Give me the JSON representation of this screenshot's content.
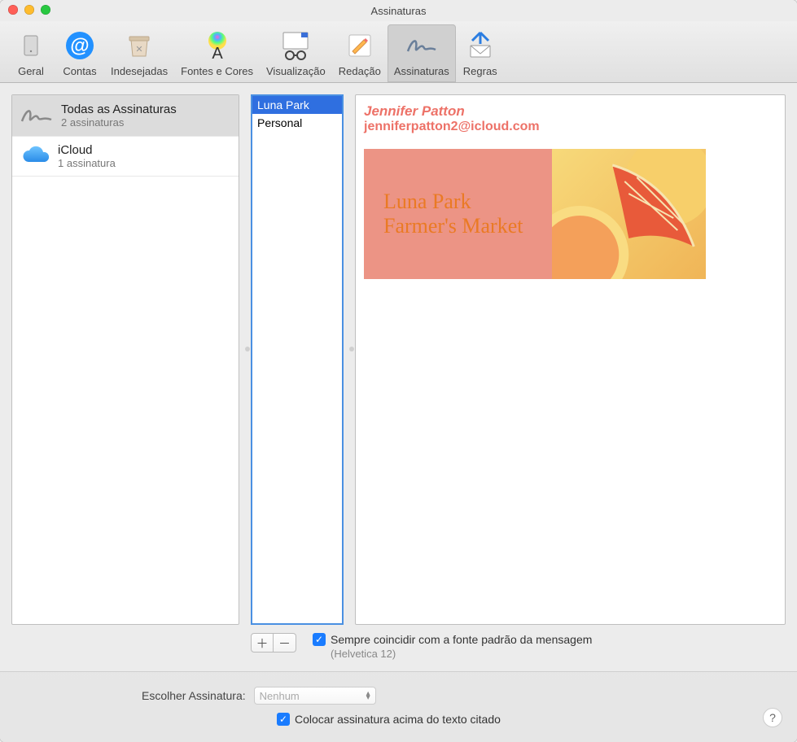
{
  "window": {
    "title": "Assinaturas"
  },
  "toolbar": {
    "items": [
      {
        "label": "Geral"
      },
      {
        "label": "Contas"
      },
      {
        "label": "Indesejadas"
      },
      {
        "label": "Fontes e Cores"
      },
      {
        "label": "Visualização"
      },
      {
        "label": "Redação"
      },
      {
        "label": "Assinaturas"
      },
      {
        "label": "Regras"
      }
    ],
    "active_index": 6
  },
  "accounts": [
    {
      "title": "Todas as Assinaturas",
      "subtitle": "2 assinaturas",
      "icon": "signature"
    },
    {
      "title": "iCloud",
      "subtitle": "1 assinatura",
      "icon": "icloud"
    }
  ],
  "accounts_selected_index": 0,
  "signatures": [
    {
      "name": "Luna Park"
    },
    {
      "name": "Personal"
    }
  ],
  "signatures_selected_index": 0,
  "preview": {
    "name": "Jennifer Patton",
    "email": "jenniferpatton2@icloud.com",
    "banner_line1": "Luna Park",
    "banner_line2": "Farmer's Market"
  },
  "options": {
    "always_match_label": "Sempre coincidir com a fonte padrão da mensagem",
    "font_hint": "(Helvetica 12)",
    "always_match_checked": true,
    "choose_label": "Escolher Assinatura:",
    "choose_value": "Nenhum",
    "place_above_label": "Colocar assinatura acima do texto citado",
    "place_above_checked": true
  }
}
